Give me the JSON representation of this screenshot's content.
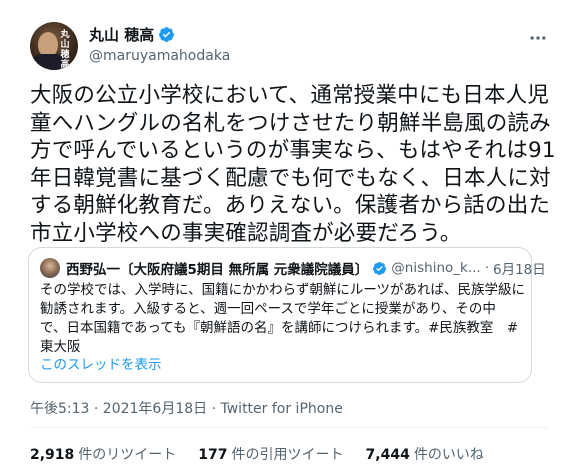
{
  "author": {
    "display_name": "丸山 穂高",
    "handle": "@maruyamahodaka",
    "avatar_text": "丸山穂高"
  },
  "tweet": {
    "lines": [
      "大阪の公立小学校において、通常授業中にも日本人児",
      "童へハングルの名札をつけさせたり朝鮮半島風の読み",
      "方で呼んでいるというのが事実なら、もはやそれは91",
      "年日韓覚書に基づく配慮でも何でもなく、日本人に対",
      "する朝鮮化教育だ。ありえない。保護者から話の出た",
      "市立小学校への事実確認調査が必要だろう。"
    ]
  },
  "quoted": {
    "name": "西野弘一〔大阪府議5期目 無所属 元衆議院議員〕",
    "handle": "@nishino_k...",
    "separator": "·",
    "date": "6月18日",
    "lines": [
      "その学校では、入学時に、国籍にかかわらず朝鮮にルーツがあれば、民族学級に",
      "勧誘されます。入級すると、週一回ペースで学年ごとに授業があり、その中",
      "で、日本国籍であっても『朝鮮語の名』を講師につけられます。#民族教室　#",
      "東大阪"
    ],
    "thread_link": "このスレッドを表示"
  },
  "meta": {
    "timestamp": "午後5:13 · 2021年6月18日 · Twitter for iPhone"
  },
  "stats": {
    "retweets_count": "2,918",
    "retweets_label": "件のリツイート",
    "quotes_count": "177",
    "quotes_label": "件の引用ツイート",
    "likes_count": "7,444",
    "likes_label": "件のいいね"
  },
  "colors": {
    "verified": "#1d9bf0",
    "link": "#1d9bf0",
    "secondary_text": "#536471",
    "border": "#cfd9de"
  },
  "icons": {
    "verified": "verified-badge-icon",
    "more": "more-options-icon"
  }
}
